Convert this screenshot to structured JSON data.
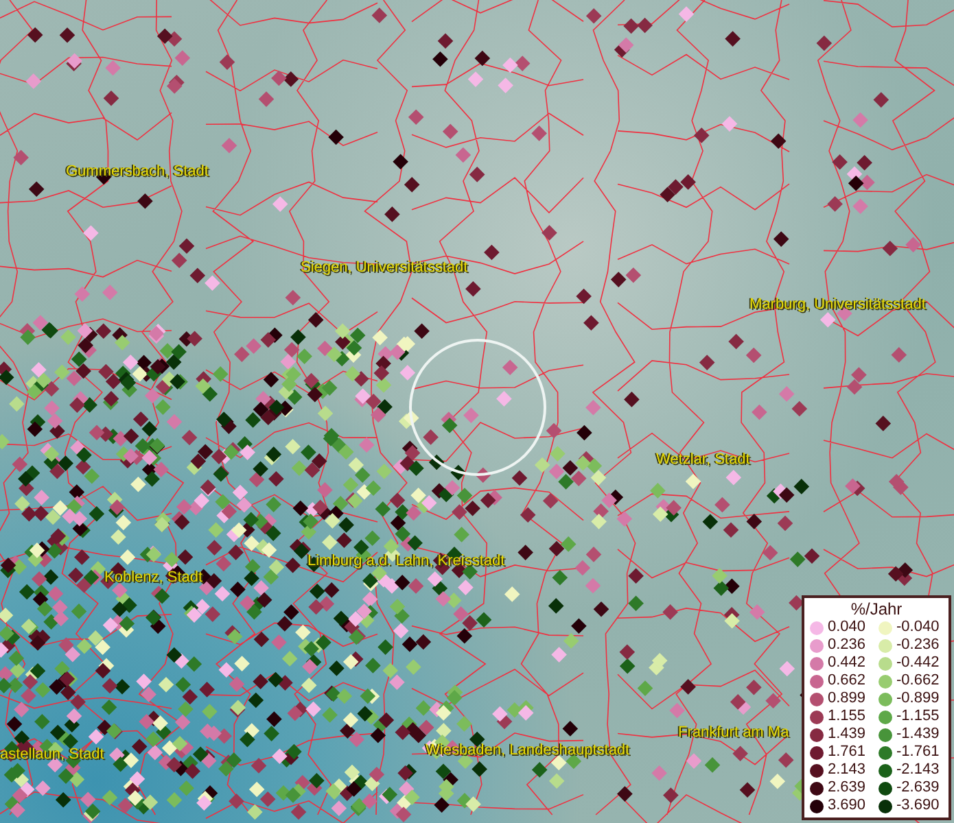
{
  "map": {
    "places": [
      {
        "name": "Gummersbach, Stadt"
      },
      {
        "name": "Siegen, Universitätsstadt"
      },
      {
        "name": "Marburg, Universitätsstadt"
      },
      {
        "name": "Wetzlar, Stadt"
      },
      {
        "name": "Limburg a.d. Lahn, Kreisstadt"
      },
      {
        "name": "Koblenz, Stadt"
      },
      {
        "name": "Frankfurt am Ma"
      },
      {
        "name": "astellaun, Stadt"
      },
      {
        "name": "Wiesbaden, Landeshauptstadt"
      }
    ]
  },
  "legend": {
    "title": "%/Jahr",
    "positive": [
      {
        "value": "0.040",
        "color": "#f5b8e6"
      },
      {
        "value": "0.236",
        "color": "#e89ccc"
      },
      {
        "value": "0.442",
        "color": "#d47aa8"
      },
      {
        "value": "0.662",
        "color": "#c86690"
      },
      {
        "value": "0.899",
        "color": "#b44f70"
      },
      {
        "value": "1.155",
        "color": "#9c3a55"
      },
      {
        "value": "1.439",
        "color": "#862a42"
      },
      {
        "value": "1.761",
        "color": "#6e1a30"
      },
      {
        "value": "2.143",
        "color": "#561020"
      },
      {
        "value": "2.639",
        "color": "#3e0814"
      },
      {
        "value": "3.690",
        "color": "#240008"
      }
    ],
    "negative": [
      {
        "value": "-0.040",
        "color": "#f0f5c0"
      },
      {
        "value": "-0.236",
        "color": "#d8eca8"
      },
      {
        "value": "-0.442",
        "color": "#b8dc8c"
      },
      {
        "value": "-0.662",
        "color": "#98cc70"
      },
      {
        "value": "-0.899",
        "color": "#7cbc5c"
      },
      {
        "value": "-1.155",
        "color": "#5ea848"
      },
      {
        "value": "-1.439",
        "color": "#48943a"
      },
      {
        "value": "-1.761",
        "color": "#2e7a28"
      },
      {
        "value": "-2.143",
        "color": "#1c621a"
      },
      {
        "value": "-2.639",
        "color": "#104a10"
      },
      {
        "value": "-3.690",
        "color": "#083008"
      }
    ]
  }
}
